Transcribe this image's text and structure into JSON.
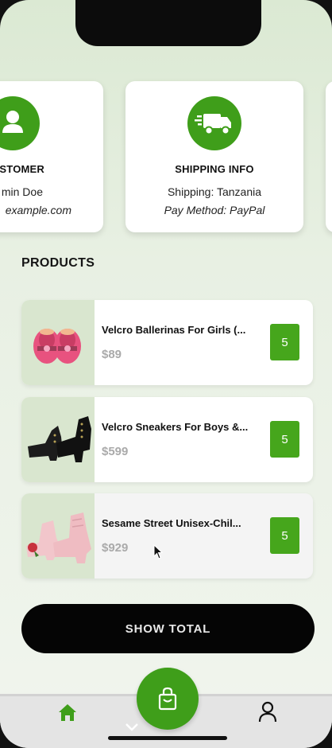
{
  "customer_card": {
    "title": "STOMER",
    "name": "min Doe",
    "email": "example.com",
    "icon": "user-icon"
  },
  "shipping_card": {
    "title": "SHIPPING INFO",
    "shipping": "Shipping: Tanzania",
    "pay_method": "Pay Method: PayPal",
    "icon": "delivery-truck-icon"
  },
  "products_heading": "PRODUCTS",
  "products": [
    {
      "name": "Velcro Ballerinas For Girls  (...",
      "price": "$89",
      "qty": "5",
      "image": "pink-ballerina-shoes"
    },
    {
      "name": "Velcro Sneakers For Boys &...",
      "price": "$599",
      "qty": "5",
      "image": "black-heeled-boots"
    },
    {
      "name": "Sesame Street Unisex-Chil...",
      "price": "$929",
      "qty": "5",
      "image": "pink-floral-boots"
    }
  ],
  "show_total_label": "SHOW TOTAL",
  "bottom_nav": {
    "home_icon": "home-icon",
    "cart_icon": "shopping-bag-icon",
    "profile_icon": "profile-icon"
  },
  "colors": {
    "accent": "#3f9e1a",
    "qty_badge": "#46a61c",
    "button_bg": "#050505"
  }
}
